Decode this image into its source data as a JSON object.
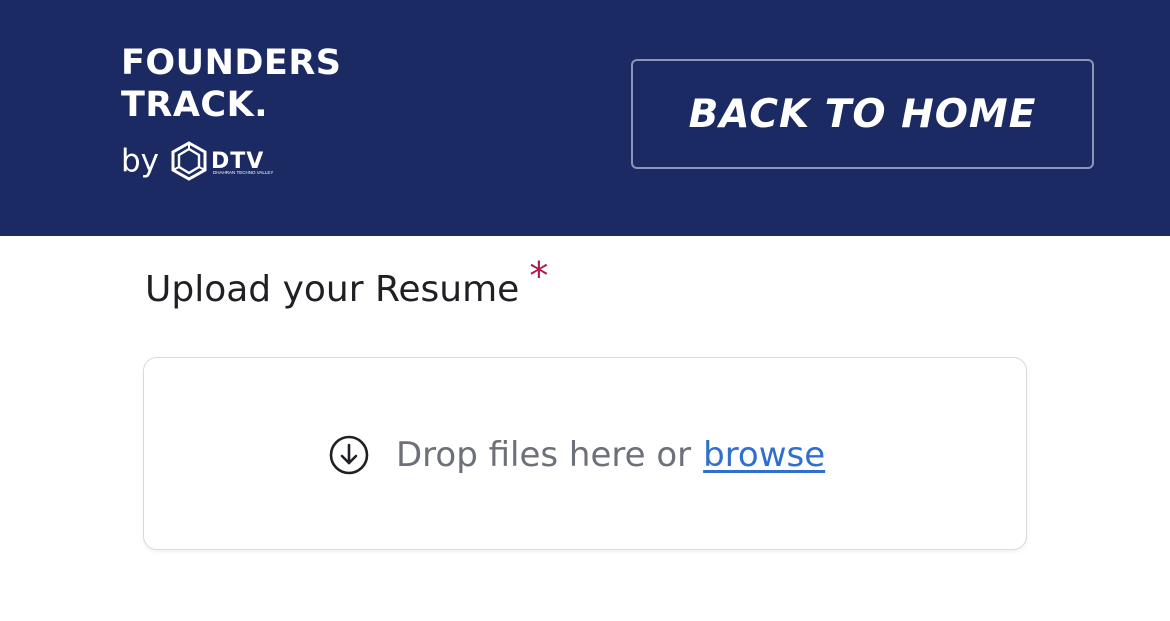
{
  "header": {
    "background": "#1b2a63",
    "logo": {
      "line1": "FOUNDERS",
      "line2": "TRACK.",
      "by": "by",
      "partner": "DTV",
      "partner_subtitle": "DHAHRAN TECHNO VALLEY"
    },
    "back_button_label": "BACK TO HOME"
  },
  "form": {
    "label": "Upload your Resume",
    "required_mark": "*",
    "dropzone": {
      "icon": "download-circle-icon",
      "text": "Drop files here or",
      "browse_label": "browse"
    }
  },
  "colors": {
    "required": "#b0184f",
    "link": "#2f6fcf"
  }
}
